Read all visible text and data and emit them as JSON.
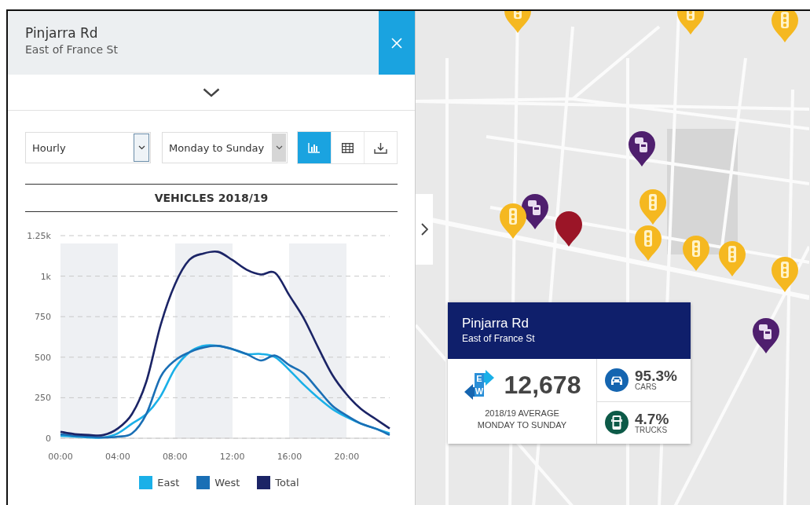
{
  "panel": {
    "title": "Pinjarra Rd",
    "subtitle": "East of France St"
  },
  "controls": {
    "period": "Hourly",
    "days": "Monday to Sunday",
    "views": [
      {
        "kind": "chart",
        "selected": true
      },
      {
        "kind": "table",
        "selected": false
      },
      {
        "kind": "download",
        "selected": false
      }
    ]
  },
  "chart": {
    "title": "VEHICLES 2018/19",
    "chart_data": {
      "type": "line",
      "grid": true,
      "x": [
        0,
        1,
        2,
        3,
        4,
        5,
        6,
        7,
        8,
        9,
        10,
        11,
        12,
        13,
        14,
        15,
        16,
        17,
        18,
        19,
        20,
        21,
        22,
        23
      ],
      "xlim": [
        0,
        23
      ],
      "ylim": [
        0,
        1250
      ],
      "xticks": [
        {
          "value": 0,
          "label": "00:00"
        },
        {
          "value": 4,
          "label": "04:00"
        },
        {
          "value": 8,
          "label": "08:00"
        },
        {
          "value": 12,
          "label": "12:00"
        },
        {
          "value": 16,
          "label": "16:00"
        },
        {
          "value": 20,
          "label": "20:00"
        }
      ],
      "yticks": [
        0,
        250,
        500,
        750,
        {
          "value": 1000,
          "label": "1k"
        },
        {
          "value": 1250,
          "label": "1.25k"
        }
      ],
      "series": [
        {
          "name": "East",
          "color": "#1ab0e8",
          "values": [
            15,
            10,
            5,
            5,
            30,
            90,
            150,
            260,
            430,
            530,
            570,
            570,
            550,
            520,
            520,
            500,
            420,
            330,
            250,
            180,
            130,
            90,
            60,
            30
          ]
        },
        {
          "name": "West",
          "color": "#1a6fb5",
          "values": [
            25,
            15,
            10,
            5,
            10,
            30,
            150,
            380,
            480,
            530,
            560,
            570,
            550,
            520,
            480,
            510,
            450,
            400,
            300,
            200,
            140,
            90,
            60,
            20
          ]
        },
        {
          "name": "Total",
          "color": "#1b2466",
          "values": [
            40,
            25,
            20,
            20,
            60,
            150,
            350,
            700,
            950,
            1100,
            1140,
            1150,
            1100,
            1040,
            1010,
            1020,
            880,
            740,
            560,
            390,
            270,
            180,
            120,
            60
          ]
        }
      ]
    }
  },
  "info_card": {
    "title": "Pinjarra Rd",
    "subtitle": "East of France St",
    "direction_letters": [
      "E",
      "W"
    ],
    "count": "12,678",
    "caption": "2018/19 AVERAGE MONDAY TO SUNDAY",
    "shares": [
      {
        "kind": "cars",
        "value": "95.3%",
        "label": "CARS"
      },
      {
        "kind": "trucks",
        "value": "4.7%",
        "label": "TRUCKS"
      }
    ]
  }
}
